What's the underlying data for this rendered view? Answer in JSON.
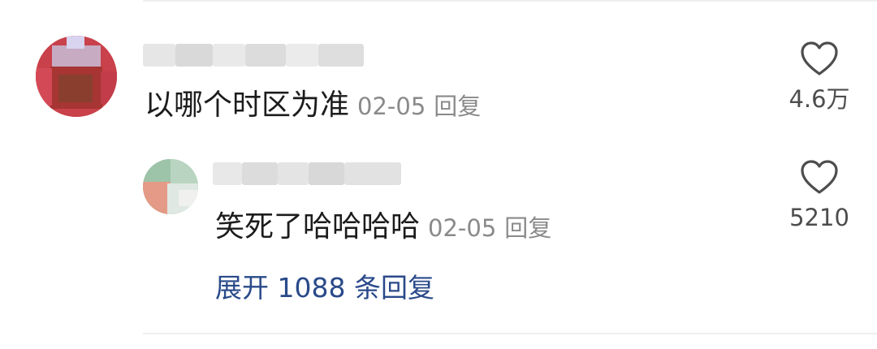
{
  "comment": {
    "text": "以哪个时区为准",
    "time": "02-05",
    "reply_label": "回复",
    "like_count": "4.6万",
    "like_icon": "heart-outline-icon"
  },
  "reply": {
    "text": "笑死了哈哈哈哈",
    "time": "02-05",
    "reply_label": "回复",
    "like_count": "5210",
    "like_icon": "heart-outline-icon"
  },
  "expand": {
    "label": "展开 1088 条回复"
  },
  "colors": {
    "link": "#2a4a8a",
    "meta": "#8a8a8a"
  }
}
